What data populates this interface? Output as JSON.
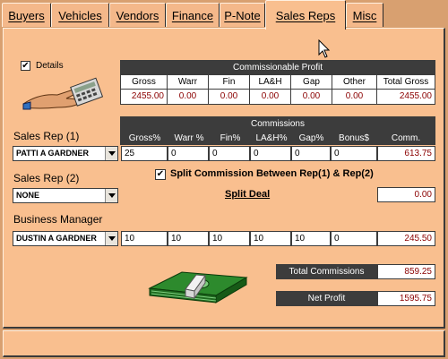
{
  "tabs": [
    {
      "label": "Buyers"
    },
    {
      "label": "Vehicles"
    },
    {
      "label": "Vendors"
    },
    {
      "label": "Finance"
    },
    {
      "label": "P-Note"
    },
    {
      "label": "Sales Reps"
    },
    {
      "label": "Misc"
    }
  ],
  "details_label": "Details",
  "commissionable": {
    "title": "Commissionable Profit",
    "headers": [
      "Gross",
      "Warr",
      "Fin",
      "LA&H",
      "Gap",
      "Other",
      "Total Gross"
    ],
    "values": [
      "2455.00",
      "0.00",
      "0.00",
      "0.00",
      "0.00",
      "0.00",
      "2455.00"
    ]
  },
  "commissions": {
    "title": "Commissions",
    "headers": [
      "Gross%",
      "Warr %",
      "Fin%",
      "LA&H%",
      "Gap%",
      "Bonus$",
      "Comm."
    ]
  },
  "rep1": {
    "label": "Sales Rep (1)",
    "selected": "PATTI A GARDNER",
    "values": [
      "25",
      "0",
      "0",
      "0",
      "0",
      "0"
    ],
    "comm": "613.75"
  },
  "rep2": {
    "label": "Sales Rep (2)",
    "selected": "NONE",
    "comm": "0.00"
  },
  "split_label": "Split Commission Between Rep(1) & Rep(2)",
  "split_deal": "Split Deal",
  "manager": {
    "label": "Business Manager",
    "selected": "DUSTIN A GARDNER",
    "values": [
      "10",
      "10",
      "10",
      "10",
      "10",
      "0"
    ],
    "comm": "245.50"
  },
  "total_commissions": {
    "label": "Total Commissions",
    "value": "859.25"
  },
  "net_profit": {
    "label": "Net Profit",
    "value": "1595.75"
  }
}
